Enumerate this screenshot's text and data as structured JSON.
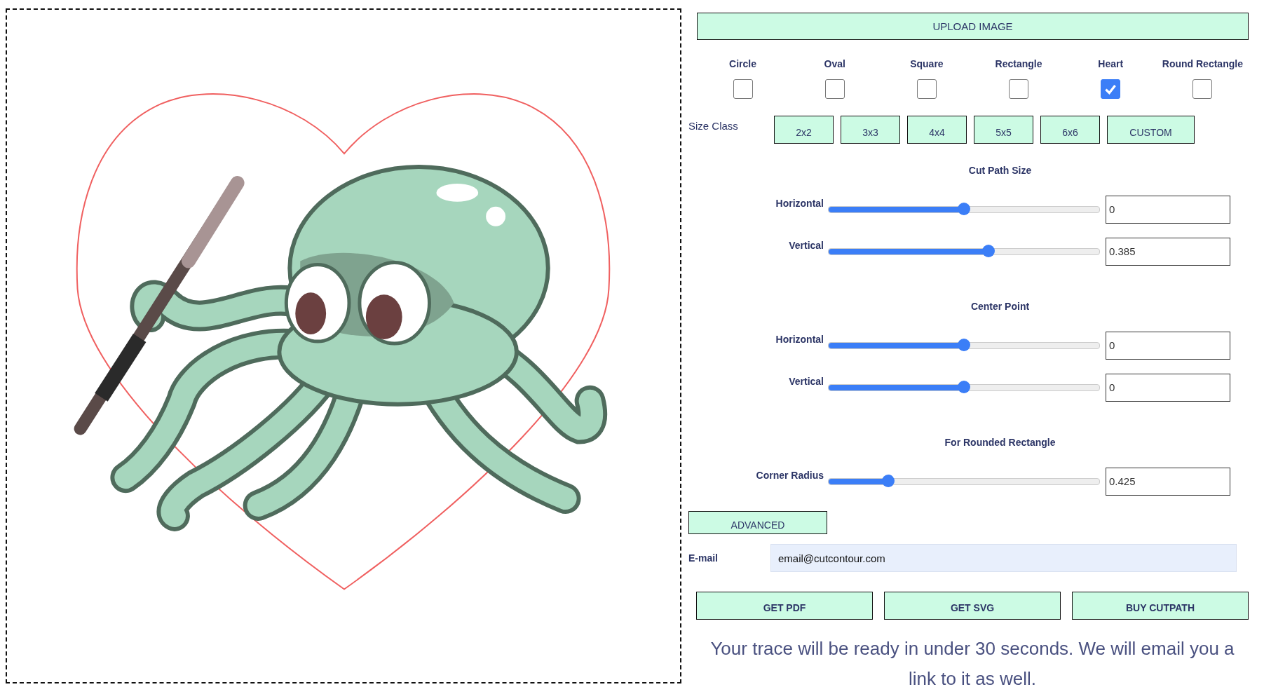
{
  "upload_button": "UPLOAD IMAGE",
  "shapes": [
    {
      "label": "Circle",
      "checked": false
    },
    {
      "label": "Oval",
      "checked": false
    },
    {
      "label": "Square",
      "checked": false
    },
    {
      "label": "Rectangle",
      "checked": false
    },
    {
      "label": "Heart",
      "checked": true
    },
    {
      "label": "Round Rectangle",
      "checked": false
    }
  ],
  "size_class": {
    "label": "Size Class",
    "options": [
      "2x2",
      "3x3",
      "4x4",
      "5x5",
      "6x6",
      "CUSTOM"
    ]
  },
  "sections": [
    {
      "title": "Cut Path Size",
      "sliders": [
        {
          "label": "Horizontal",
          "level": 0.5,
          "value": "0"
        },
        {
          "label": "Vertical",
          "level": 0.59,
          "value": "0.385"
        }
      ]
    },
    {
      "title": "Center Point",
      "sliders": [
        {
          "label": "Horizontal",
          "level": 0.5,
          "value": "0"
        },
        {
          "label": "Vertical",
          "level": 0.5,
          "value": "0"
        }
      ]
    },
    {
      "title": "For Rounded Rectangle",
      "sliders": [
        {
          "label": "Corner Radius",
          "level": 0.22,
          "value": "0.425"
        }
      ]
    }
  ],
  "advanced_button": "ADVANCED",
  "email": {
    "label": "E-mail",
    "value": "email@cutcontour.com"
  },
  "actions": [
    "GET PDF",
    "GET SVG",
    "BUY CUTPATH"
  ],
  "notice": "Your trace will be ready in under 30 seconds. We will email you a link to it as well."
}
